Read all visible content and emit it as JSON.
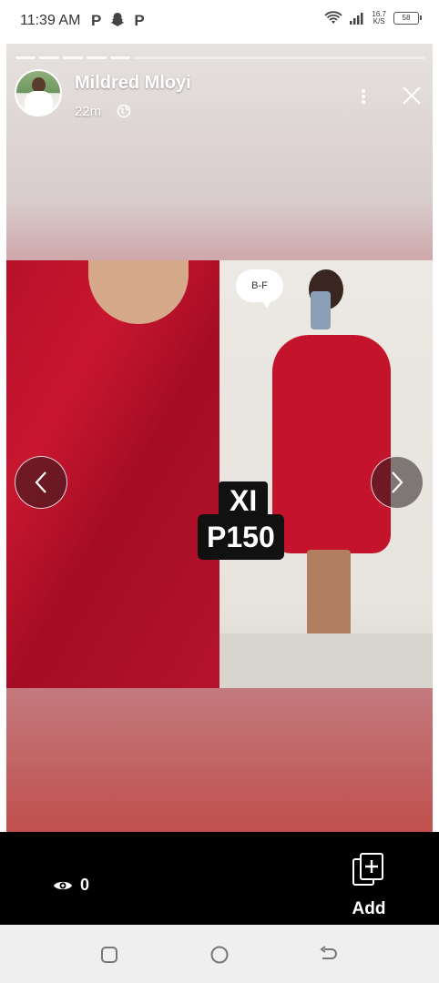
{
  "status_bar": {
    "time": "11:39 AM",
    "left_icons": [
      "P",
      "P"
    ],
    "net_speed_value": "16.7",
    "net_speed_unit": "K/S",
    "battery_level": "58"
  },
  "story": {
    "poster_name": "Mildred Mloyi",
    "posted_ago": "22m",
    "image": {
      "bubble_text": "B-F",
      "size_label": "XI",
      "price_label": "P150"
    }
  },
  "bottom_bar": {
    "viewer_count": "0",
    "add_label": "Add"
  },
  "icons": {
    "status_wifi": "wifi-icon",
    "status_signal": "signal-icon",
    "snapchat": "snapchat-icon",
    "privacy": "globe-icon",
    "more": "more-vertical-icon",
    "close": "close-icon",
    "prev": "chevron-left-icon",
    "next": "chevron-right-icon",
    "views": "eye-icon",
    "add": "add-story-icon"
  },
  "colors": {
    "dress_red": "#c4142c",
    "bottom_bar": "#000000",
    "system_nav": "#efefef"
  }
}
